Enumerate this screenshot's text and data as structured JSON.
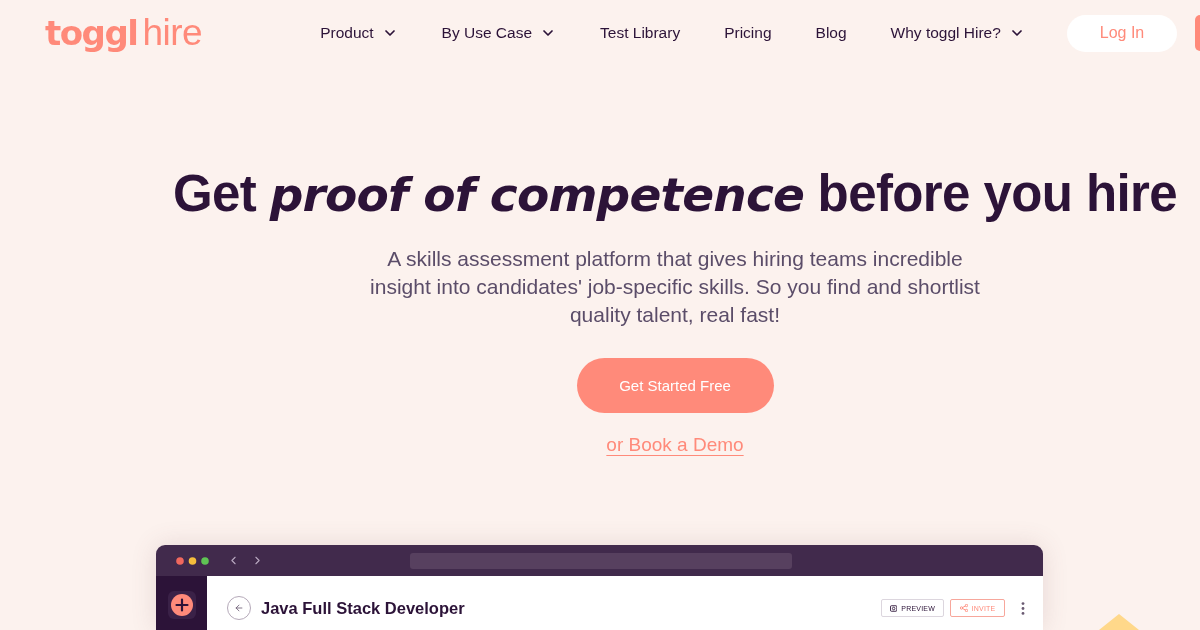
{
  "header": {
    "logo": {
      "brand": "toggl",
      "product": "hire"
    },
    "nav": [
      {
        "label": "Product",
        "has_menu": true
      },
      {
        "label": "By Use Case",
        "has_menu": true
      },
      {
        "label": "Test Library",
        "has_menu": false
      },
      {
        "label": "Pricing",
        "has_menu": false
      },
      {
        "label": "Blog",
        "has_menu": false
      },
      {
        "label": "Why toggl Hire?",
        "has_menu": true
      }
    ],
    "login": "Log In"
  },
  "hero": {
    "title": "Get *proof of competence* before you hire",
    "subtitle_lines": [
      "A skills assessment platform that gives hiring teams incredible",
      "insight into candidates' job-specific skills. So you find and shortlist",
      "quality talent, real fast!"
    ],
    "cta": "Get Started Free",
    "demo_link": "or Book a Demo"
  },
  "app_preview": {
    "title": "Java Full Stack Developer",
    "actions": [
      {
        "label": "PREVIEW",
        "kind": "preview"
      },
      {
        "label": "INVITE",
        "kind": "invite"
      }
    ]
  }
}
